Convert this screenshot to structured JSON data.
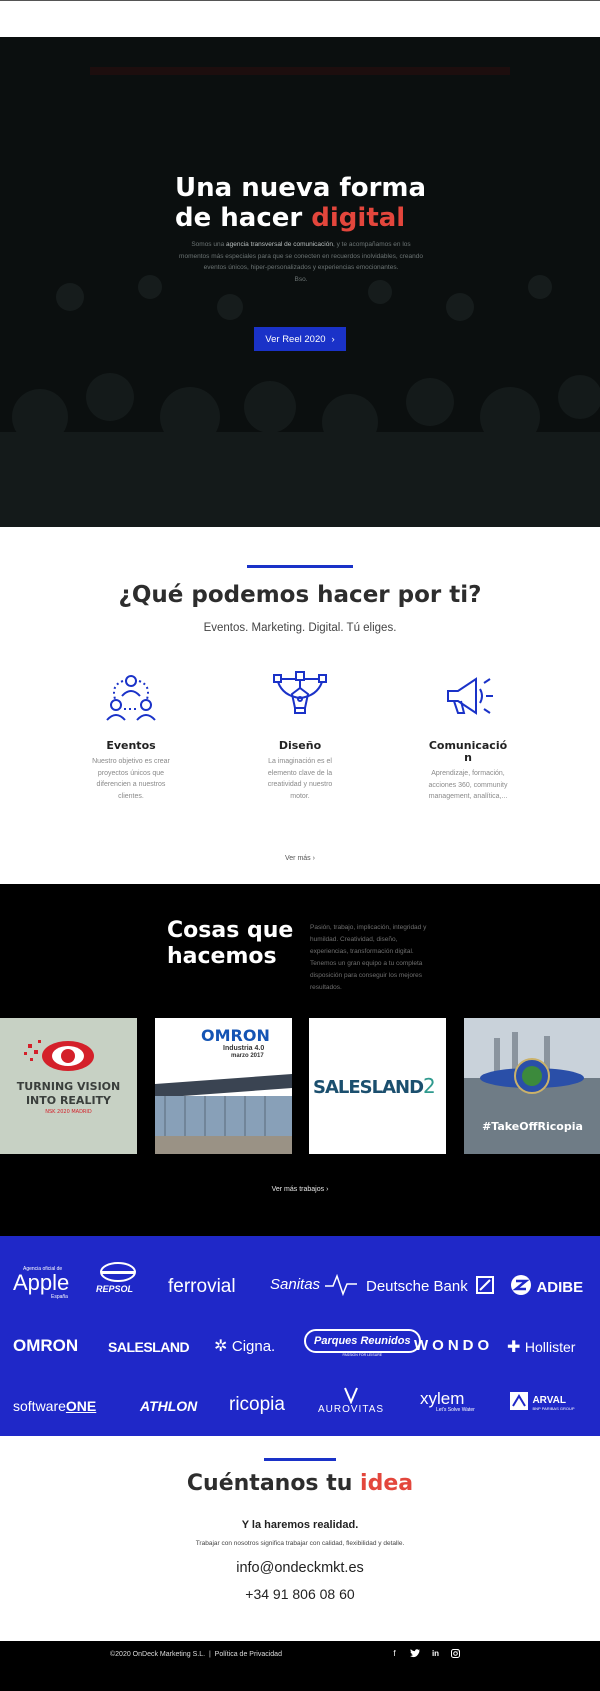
{
  "hero": {
    "title_line1": "Una nueva forma",
    "title_line2_prefix": "de hacer ",
    "title_accent": "digital",
    "intro_before": "Somos una ",
    "intro_highlight": "agencia transversal de comunicación",
    "intro_after": ", y te acompañamos en los momentos más especiales para que se conecten en recuerdos inolvidables, creando eventos únicos, hiper-personalizados y experiencias emocionantes.",
    "intro_tail": "Bso.",
    "reel_button": "Ver Reel 2020",
    "reel_chevron": "›"
  },
  "services": {
    "title": "¿Qué podemos hacer por ti?",
    "subtitle": "Eventos. Marketing. Digital. Tú eliges.",
    "items": [
      {
        "icon": "people-network-icon",
        "title": "Eventos",
        "text": "Nuestro objetivo es crear proyectos únicos que diferencien a nuestros clientes."
      },
      {
        "icon": "pen-tool-icon",
        "title": "Diseño",
        "text": "La imaginación es el elemento clave de la creatividad y nuestro motor."
      },
      {
        "icon": "megaphone-icon",
        "title": "Comunicació n",
        "text": "Aprendizaje, formación, acciones 360, community management, analítica,..."
      }
    ],
    "more": "Ver más",
    "more_chevron": "›"
  },
  "works": {
    "title_line1": "Cosas que",
    "title_line2": "hacemos",
    "description": "Pasión, trabajo, implicación, integridad y humildad. Creatividad, diseño, experiencias, transformación digital. Tenemos un gran equipo a tu completa disposición para conseguir los mejores resultados.",
    "tiles": [
      {
        "line1": "TURNING VISION",
        "line2": "INTO REALITY",
        "line3": "NSK 2020 MADRID"
      },
      {
        "brand": "OMRON",
        "line1": "Industria 4.0",
        "line2": "marzo 2017"
      },
      {
        "brand": "SALESLAND",
        "suffix": "2"
      },
      {
        "hashtag": "#TakeOffRicopia"
      }
    ],
    "more": "Ver más trabajos",
    "more_chevron": "›"
  },
  "clients": {
    "logos": [
      {
        "name": "Apple",
        "small": "Agencia oficial de",
        "sub": "España"
      },
      {
        "name": "REPSOL"
      },
      {
        "name": "ferrovial"
      },
      {
        "name": "Sanitas"
      },
      {
        "name": "Deutsche Bank"
      },
      {
        "name": "ADIBE"
      },
      {
        "name": "OMRON"
      },
      {
        "name": "SALESLAND"
      },
      {
        "name": "Cigna."
      },
      {
        "name": "Parques Reunidos",
        "sub": "PASSION FOR LEISURE"
      },
      {
        "name": "WONDO"
      },
      {
        "name": "Hollister"
      },
      {
        "name": "software",
        "suffix": "ONE"
      },
      {
        "name": "ATHLON"
      },
      {
        "name": "ricopia"
      },
      {
        "name": "AUROVITAS"
      },
      {
        "name": "xylem",
        "sub": "Let's Solve Water"
      },
      {
        "name": "ARVAL",
        "sub": "BNP PARIBAS GROUP"
      }
    ]
  },
  "contact": {
    "title_prefix": "Cuéntanos tu ",
    "title_accent": "idea",
    "tagline": "Y la haremos realidad.",
    "small": "Trabajar con nosotros significa trabajar con calidad, flexibilidad y detalle.",
    "email": "info@ondeckmkt.es",
    "phone": "+34 91 806 08 60"
  },
  "footer": {
    "copyright": "©2020 OnDeck Marketing S.L.",
    "separator": "|",
    "privacy": "Política de Privacidad",
    "social": [
      "f",
      "t",
      "in",
      "ig"
    ]
  },
  "colors": {
    "accent": "#e3463c",
    "brand_blue": "#1f28c8",
    "button_blue": "#1a32c8"
  }
}
